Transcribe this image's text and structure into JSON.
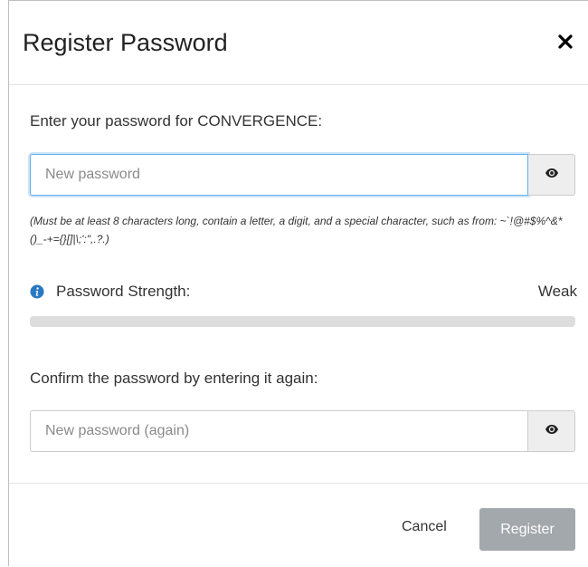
{
  "dialog": {
    "title": "Register Password",
    "close_icon": "close-icon"
  },
  "body": {
    "prompt": "Enter your password for CONVERGENCE:",
    "password": {
      "value": "",
      "placeholder": "New password",
      "reveal_icon": "eye-icon"
    },
    "hint": "(Must be at least 8 characters long, contain a letter, a digit, and a special character, such as from: ~`!@#$%^&*()_-+={}[]|\\;':\",.?.)",
    "strength": {
      "info_icon": "info-icon",
      "label": "Password Strength:",
      "value": "Weak",
      "level": 0
    },
    "confirm_prompt": "Confirm the password by entering it again:",
    "confirm_password": {
      "value": "",
      "placeholder": "New password (again)",
      "reveal_icon": "eye-icon"
    }
  },
  "footer": {
    "cancel_label": "Cancel",
    "register_label": "Register"
  },
  "colors": {
    "focus_border": "#66afe9",
    "info_icon": "#2a78c2",
    "progress_track": "#dddddd",
    "register_disabled": "#a3a8ad"
  }
}
